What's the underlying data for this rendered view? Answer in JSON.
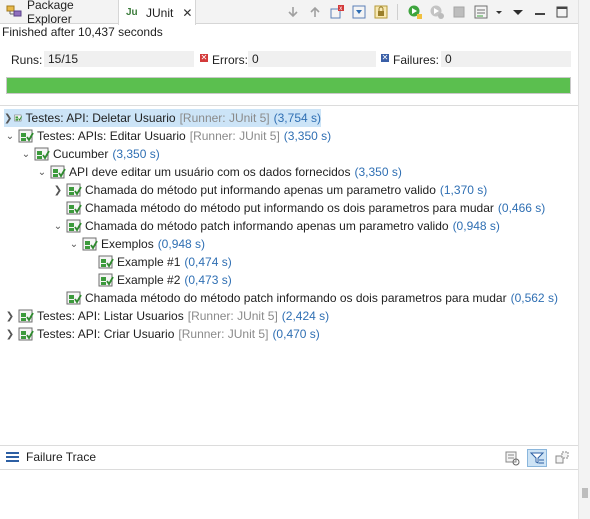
{
  "tabs": [
    {
      "label": "Package Explorer",
      "icon": "package-explorer-icon"
    },
    {
      "label": "JUnit",
      "icon": "junit-icon",
      "active": true
    }
  ],
  "toolbar": {
    "icons": [
      "next-failure-icon",
      "previous-failure-icon",
      "show-failures-only-icon",
      "scroll-lock-icon",
      "history-icon",
      "rerun-test-icon",
      "rerun-failed-first-icon",
      "stop-icon",
      "test-run-history-icon",
      "view-menu-icon",
      "minimize-icon",
      "maximize-icon"
    ]
  },
  "status": {
    "finished": "Finished after 10,437 seconds"
  },
  "counters": {
    "runs_label": "Runs:",
    "runs_value": "15/15",
    "errors_label": "Errors:",
    "errors_value": "0",
    "failures_label": "Failures:",
    "failures_value": "0"
  },
  "progress": {
    "fraction": 1.0,
    "color": "#5bbf4f"
  },
  "tree": [
    {
      "name": "Testes: API: Deletar Usuario",
      "runner": "[Runner: JUnit 5]",
      "time": "(3,754 s)",
      "selected": true
    },
    {
      "name": "Testes: APIs: Editar Usuario",
      "runner": "[Runner: JUnit 5]",
      "time": "(3,350 s)"
    },
    {
      "name": "Cucumber",
      "runner": "",
      "time": "(3,350 s)"
    },
    {
      "name": "API deve editar um usuário com os dados fornecidos",
      "runner": "",
      "time": "(3,350 s)"
    },
    {
      "name": "Chamada do método put informando apenas um parametro valido",
      "runner": "",
      "time": "(1,370 s)"
    },
    {
      "name": "Chamada método do método put informando os dois parametros para mudar",
      "runner": "",
      "time": "(0,466 s)"
    },
    {
      "name": "Chamada do método patch informando apenas um parametro valido",
      "runner": "",
      "time": "(0,948 s)"
    },
    {
      "name": "Exemplos",
      "runner": "",
      "time": "(0,948 s)"
    },
    {
      "name": "Example #1",
      "runner": "",
      "time": "(0,474 s)"
    },
    {
      "name": "Example #2",
      "runner": "",
      "time": "(0,473 s)"
    },
    {
      "name": "Chamada método do método patch informando os dois parametros para mudar",
      "runner": "",
      "time": "(0,562 s)"
    },
    {
      "name": "Testes: API: Listar Usuarios",
      "runner": "[Runner: JUnit 5]",
      "time": "(2,424 s)"
    },
    {
      "name": "Testes: API: Criar Usuario",
      "runner": "[Runner: JUnit 5]",
      "time": "(0,470 s)"
    }
  ],
  "failure_trace": {
    "title": "Failure Trace",
    "icons": [
      "compare-results-icon",
      "filter-stack-trace-icon",
      "copy-trace-icon"
    ]
  },
  "colors": {
    "pass": "#3c9a3c",
    "time": "#2f6fb3",
    "runner": "#8a8a8a",
    "selection": "#cce4f7"
  }
}
